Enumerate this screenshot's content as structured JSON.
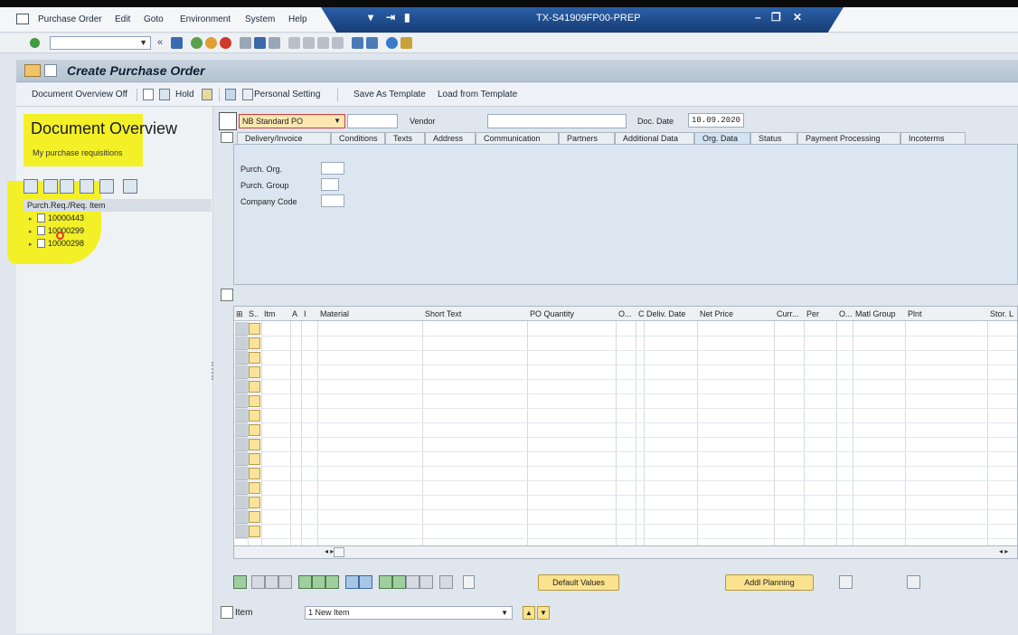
{
  "window": {
    "system_title": "TX-S41909FP00-PREP",
    "menu": [
      "Purchase Order",
      "Edit",
      "Goto",
      "Environment",
      "System",
      "Help"
    ]
  },
  "screen": {
    "title": "Create Purchase Order"
  },
  "app_toolbar": {
    "doc_overview_off": "Document Overview Off",
    "hold": "Hold",
    "personal_setting": "Personal Setting",
    "save_as_template": "Save As Template",
    "load_from_template": "Load from Template"
  },
  "left_pane": {
    "title": "Document Overview",
    "subtitle": "My purchase requisitions",
    "column_header": "Purch.Req./Req. Item",
    "items": [
      "10000443",
      "10000299",
      "10000298"
    ]
  },
  "header": {
    "doc_type": "NB Standard PO",
    "vendor_label": "Vendor",
    "vendor_value": "",
    "doc_date_label": "Doc. Date",
    "doc_date_value": "10.09.2020"
  },
  "tabs": [
    "Delivery/Invoice",
    "Conditions",
    "Texts",
    "Address",
    "Communication",
    "Partners",
    "Additional Data",
    "Org. Data",
    "Status",
    "Payment Processing",
    "Incoterms"
  ],
  "active_tab": "Org. Data",
  "org_data": {
    "purch_org": "Purch. Org.",
    "purch_group": "Purch. Group",
    "company_code": "Company Code"
  },
  "grid": {
    "columns": [
      "S..",
      "Itm",
      "A",
      "I",
      "Material",
      "Short Text",
      "PO Quantity",
      "O...",
      "C",
      "Deliv. Date",
      "Net Price",
      "Curr...",
      "Per",
      "O...",
      "Matl Group",
      "Plnt",
      "Stor. L"
    ]
  },
  "bottom_buttons": {
    "default_values": "Default Values",
    "addl_planning": "Addl Planning"
  },
  "item_row": {
    "label": "Item",
    "selected": "1 New Item"
  },
  "colors": {
    "highlight": "#f3f028",
    "title_tab": "#1f4f8f"
  }
}
